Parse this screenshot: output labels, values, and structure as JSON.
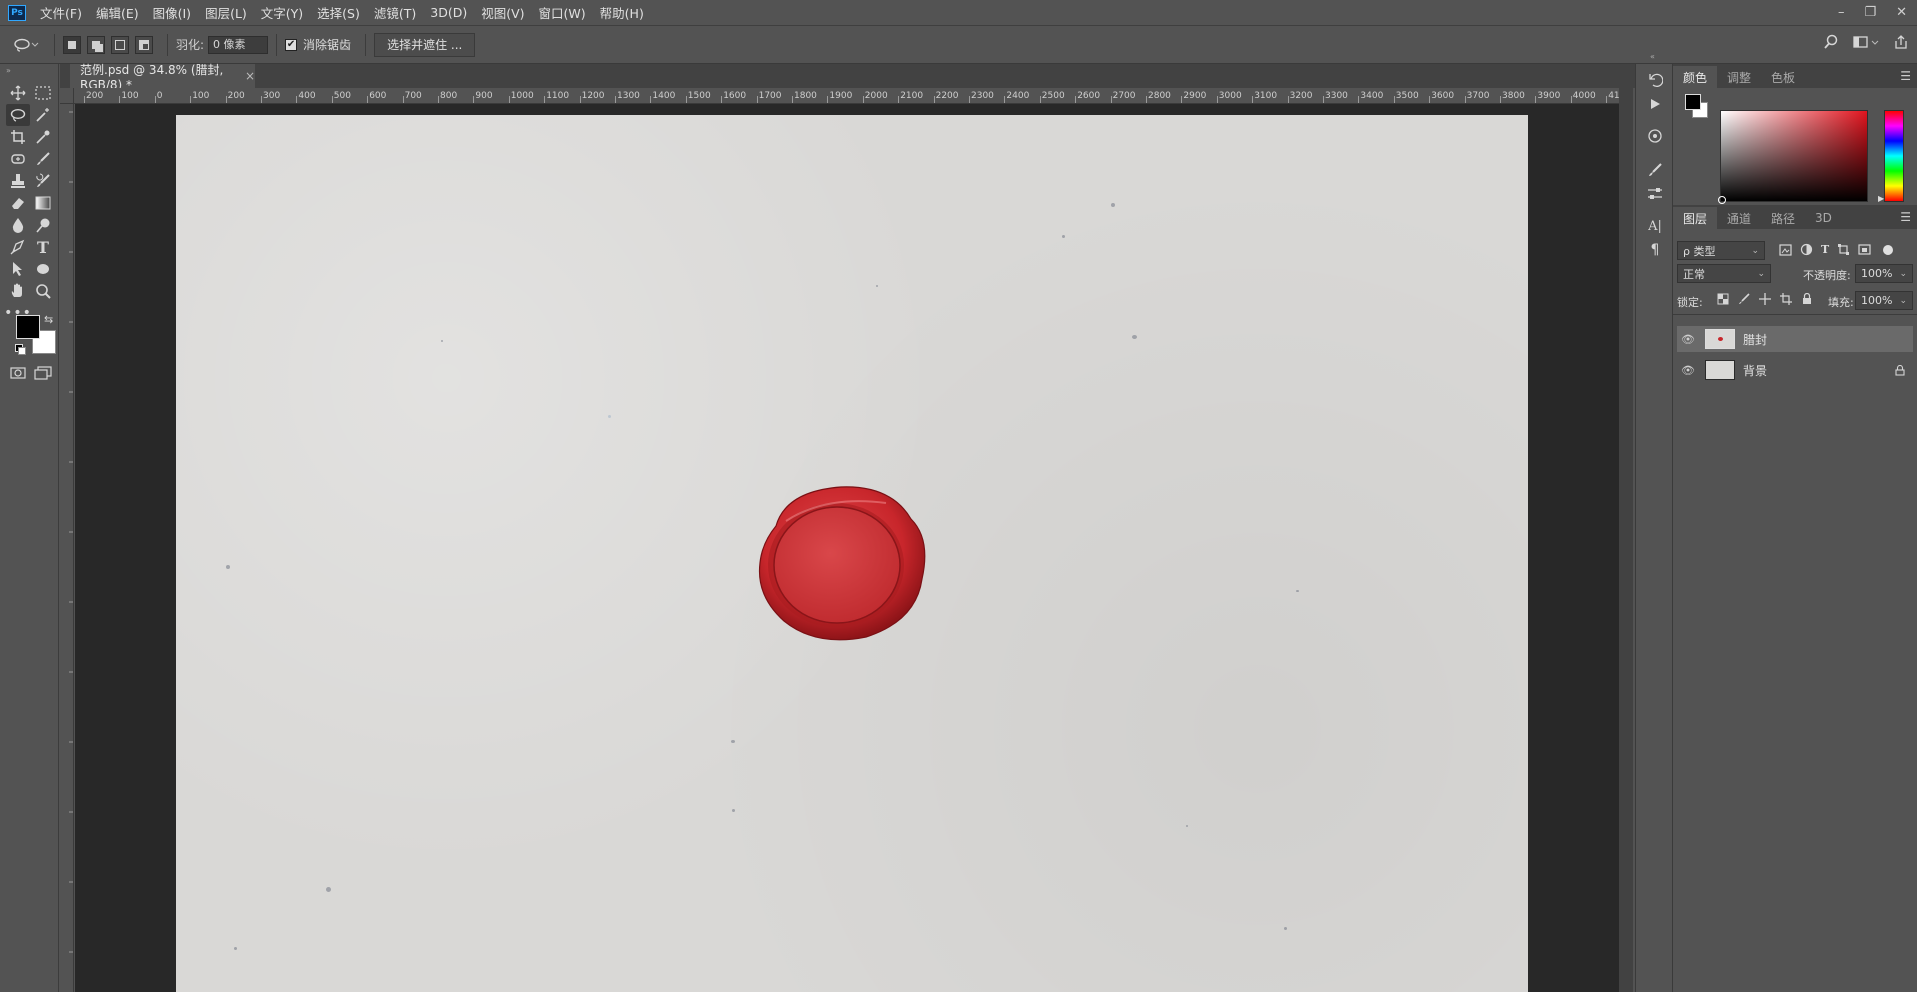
{
  "app": {
    "logo_text": "Ps"
  },
  "menubar": {
    "items": [
      "文件(F)",
      "编辑(E)",
      "图像(I)",
      "图层(L)",
      "文字(Y)",
      "选择(S)",
      "滤镜(T)",
      "3D(D)",
      "视图(V)",
      "窗口(W)",
      "帮助(H)"
    ],
    "window_controls": {
      "minimize": "–",
      "restore": "❐",
      "close": "✕"
    }
  },
  "options_bar": {
    "feather_label": "羽化:",
    "feather_value": "0 像素",
    "antialias_label": "消除锯齿",
    "antialias_checked": true,
    "select_mask_label": "选择并遮住 ..."
  },
  "document": {
    "tab_title": "范例.psd @ 34.8% (腊封, RGB/8) *",
    "tab_close": "×"
  },
  "ruler": {
    "top_labels": [
      "200",
      "100",
      "0",
      "100",
      "200",
      "300",
      "400",
      "500",
      "600",
      "700",
      "800",
      "900",
      "1000",
      "1100",
      "1200",
      "1300",
      "1400",
      "1500",
      "1600",
      "1700",
      "1800",
      "1900",
      "2000",
      "2100",
      "2200",
      "2300",
      "2400",
      "2500",
      "2600",
      "2700",
      "2800",
      "2900",
      "3000",
      "3100",
      "3200",
      "3300",
      "3400",
      "3500",
      "3600",
      "3700",
      "3800",
      "3900",
      "4000",
      "41"
    ]
  },
  "color_panel": {
    "tabs": [
      "颜色",
      "调整",
      "色板"
    ],
    "active_tab": "颜色",
    "foreground_color": "#000000",
    "background_color": "#ffffff",
    "hue_color": "#e1141e"
  },
  "layers_panel": {
    "tabs": [
      "图层",
      "通道",
      "路径",
      "3D"
    ],
    "active_tab": "图层",
    "filter_label": "ρ 类型",
    "blend_mode": "正常",
    "opacity_label": "不透明度:",
    "opacity_value": "100%",
    "lock_label": "锁定:",
    "fill_label": "填充:",
    "fill_value": "100%",
    "layers": [
      {
        "name": "腊封",
        "visible": true,
        "selected": true,
        "locked": false
      },
      {
        "name": "背景",
        "visible": true,
        "selected": false,
        "locked": true
      }
    ]
  },
  "colors": {
    "ui_bg": "#535353",
    "ui_dark": "#424242",
    "canvas_bg": "#282828",
    "paper": "#d9d8d6",
    "wax": "#c8262b"
  }
}
